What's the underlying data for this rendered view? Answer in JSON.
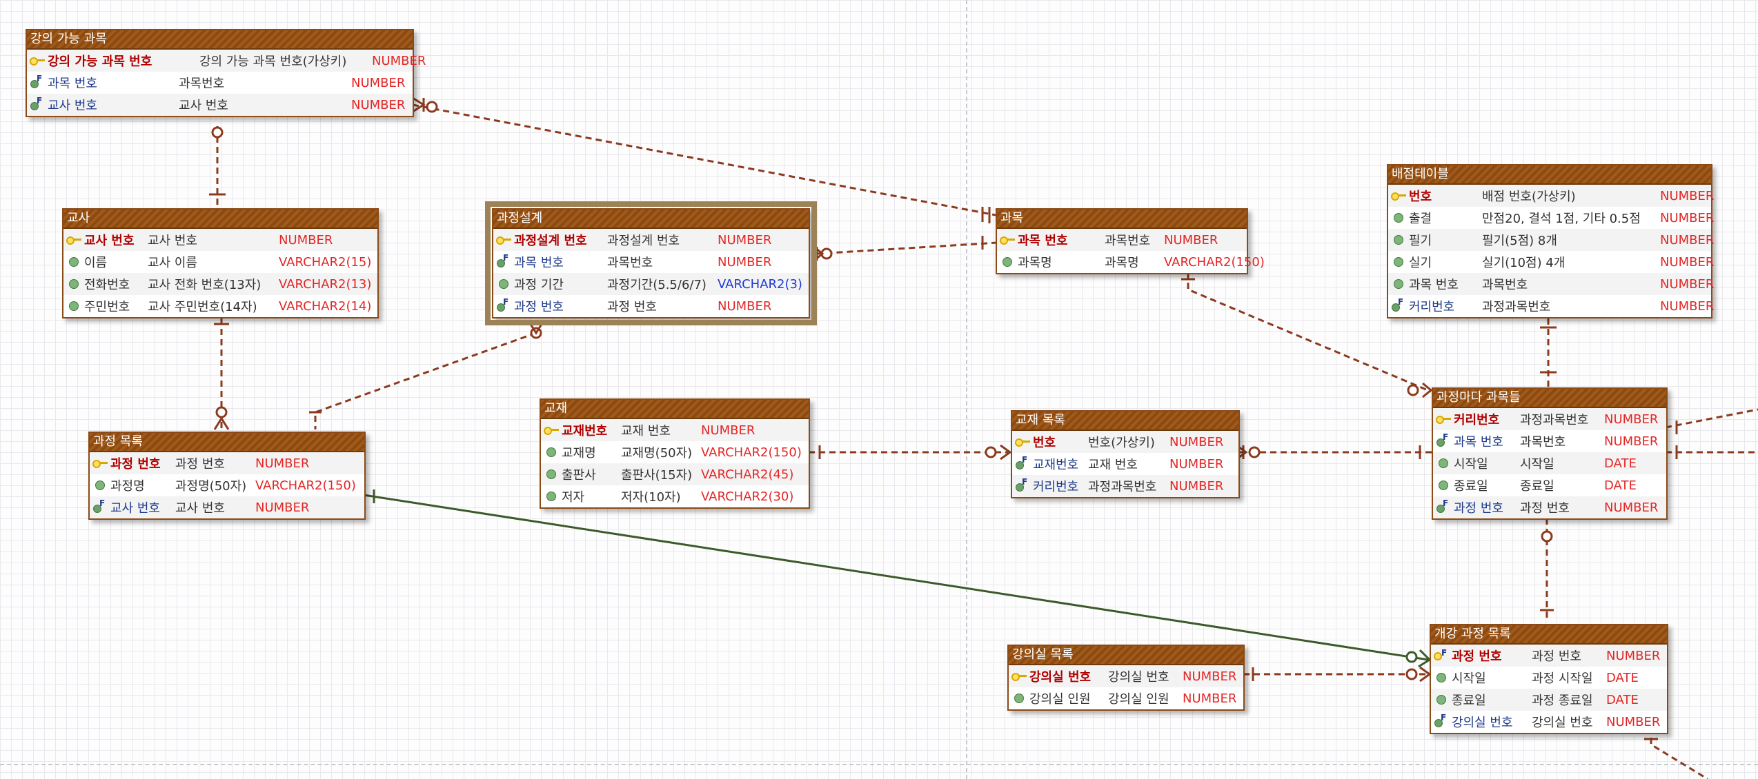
{
  "entities": {
    "lecture": {
      "title": "강의 가능 과목",
      "rows": [
        {
          "name": "강의 가능 과목 번호",
          "desc": "강의 가능 과목 번호(가상키)",
          "type": "NUMBER"
        },
        {
          "name": "과목 번호",
          "desc": "과목번호",
          "type": "NUMBER"
        },
        {
          "name": "교사 번호",
          "desc": "교사 번호",
          "type": "NUMBER"
        }
      ]
    },
    "teacher": {
      "title": "교사",
      "rows": [
        {
          "name": "교사 번호",
          "desc": "교사 번호",
          "type": "NUMBER"
        },
        {
          "name": "이름",
          "desc": "교사 이름",
          "type": "VARCHAR2(15)"
        },
        {
          "name": "전화번호",
          "desc": "교사 전화 번호(13자)",
          "type": "VARCHAR2(13)"
        },
        {
          "name": "주민번호",
          "desc": "교사 주민번호(14자)",
          "type": "VARCHAR2(14)"
        }
      ]
    },
    "design": {
      "title": "과정설계",
      "rows": [
        {
          "name": "과정설계 번호",
          "desc": "과정설계 번호",
          "type": "NUMBER"
        },
        {
          "name": "과목 번호",
          "desc": "과목번호",
          "type": "NUMBER"
        },
        {
          "name": "과정 기간",
          "desc": "과정기간(5.5/6/7)",
          "type": "VARCHAR2(3)"
        },
        {
          "name": "과정 번호",
          "desc": "과정 번호",
          "type": "NUMBER"
        }
      ]
    },
    "subject": {
      "title": "과목",
      "rows": [
        {
          "name": "과목 번호",
          "desc": "과목번호",
          "type": "NUMBER"
        },
        {
          "name": "과목명",
          "desc": "과목명",
          "type": "VARCHAR2(150)"
        }
      ]
    },
    "score": {
      "title": "배점테이블",
      "rows": [
        {
          "name": "번호",
          "desc": "배점 번호(가상키)",
          "type": "NUMBER"
        },
        {
          "name": "출결",
          "desc": "만점20, 결석 1점, 기타 0.5점",
          "type": "NUMBER"
        },
        {
          "name": "필기",
          "desc": "필기(5점) 8개",
          "type": "NUMBER"
        },
        {
          "name": "실기",
          "desc": "실기(10점) 4개",
          "type": "NUMBER"
        },
        {
          "name": "과목 번호",
          "desc": "과목번호",
          "type": "NUMBER"
        },
        {
          "name": "커리번호",
          "desc": "과정과목번호",
          "type": "NUMBER"
        }
      ]
    },
    "course_list": {
      "title": "과정 목록",
      "rows": [
        {
          "name": "과정 번호",
          "desc": "과정 번호",
          "type": "NUMBER"
        },
        {
          "name": "과정명",
          "desc": "과정명(50자)",
          "type": "VARCHAR2(150)"
        },
        {
          "name": "교사 번호",
          "desc": "교사 번호",
          "type": "NUMBER"
        }
      ]
    },
    "textbook": {
      "title": "교재",
      "rows": [
        {
          "name": "교재번호",
          "desc": "교재 번호",
          "type": "NUMBER"
        },
        {
          "name": "교재명",
          "desc": "교재명(50자)",
          "type": "VARCHAR2(150)"
        },
        {
          "name": "출판사",
          "desc": "출판사(15자)",
          "type": "VARCHAR2(45)"
        },
        {
          "name": "저자",
          "desc": "저자(10자)",
          "type": "VARCHAR2(30)"
        }
      ]
    },
    "textbook_list": {
      "title": "교재 목록",
      "rows": [
        {
          "name": "번호",
          "desc": "번호(가상키)",
          "type": "NUMBER"
        },
        {
          "name": "교재번호",
          "desc": "교재 번호",
          "type": "NUMBER"
        },
        {
          "name": "커리번호",
          "desc": "과정과목번호",
          "type": "NUMBER"
        }
      ]
    },
    "course_subjects": {
      "title": "과정마다 과목들",
      "rows": [
        {
          "name": "커리번호",
          "desc": "과정과목번호",
          "type": "NUMBER"
        },
        {
          "name": "과목 번호",
          "desc": "과목번호",
          "type": "NUMBER"
        },
        {
          "name": "시작일",
          "desc": "시작일",
          "type": "DATE"
        },
        {
          "name": "종료일",
          "desc": "종료일",
          "type": "DATE"
        },
        {
          "name": "과정 번호",
          "desc": "과정 번호",
          "type": "NUMBER"
        }
      ]
    },
    "room_list": {
      "title": "강의실 목록",
      "rows": [
        {
          "name": "강의실 번호",
          "desc": "강의실 번호",
          "type": "NUMBER"
        },
        {
          "name": "강의실 인원",
          "desc": "강의실 인원",
          "type": "NUMBER"
        }
      ]
    },
    "open_course": {
      "title": "개강 과정 목록",
      "rows": [
        {
          "name": "과정 번호",
          "desc": "과정 번호",
          "type": "NUMBER"
        },
        {
          "name": "시작일",
          "desc": "과정 시작일",
          "type": "DATE"
        },
        {
          "name": "종료일",
          "desc": "과정 종료일",
          "type": "DATE"
        },
        {
          "name": "강의실 번호",
          "desc": "강의실 번호",
          "type": "NUMBER"
        }
      ]
    }
  },
  "colors": {
    "relationship": "#8b3a1e",
    "identifying_relationship": "#3c5a2a",
    "title_bar": "#9a5418",
    "type_text": "#e32626"
  },
  "icons": [
    "primary-key-icon",
    "foreign-key-icon",
    "attribute-icon"
  ]
}
